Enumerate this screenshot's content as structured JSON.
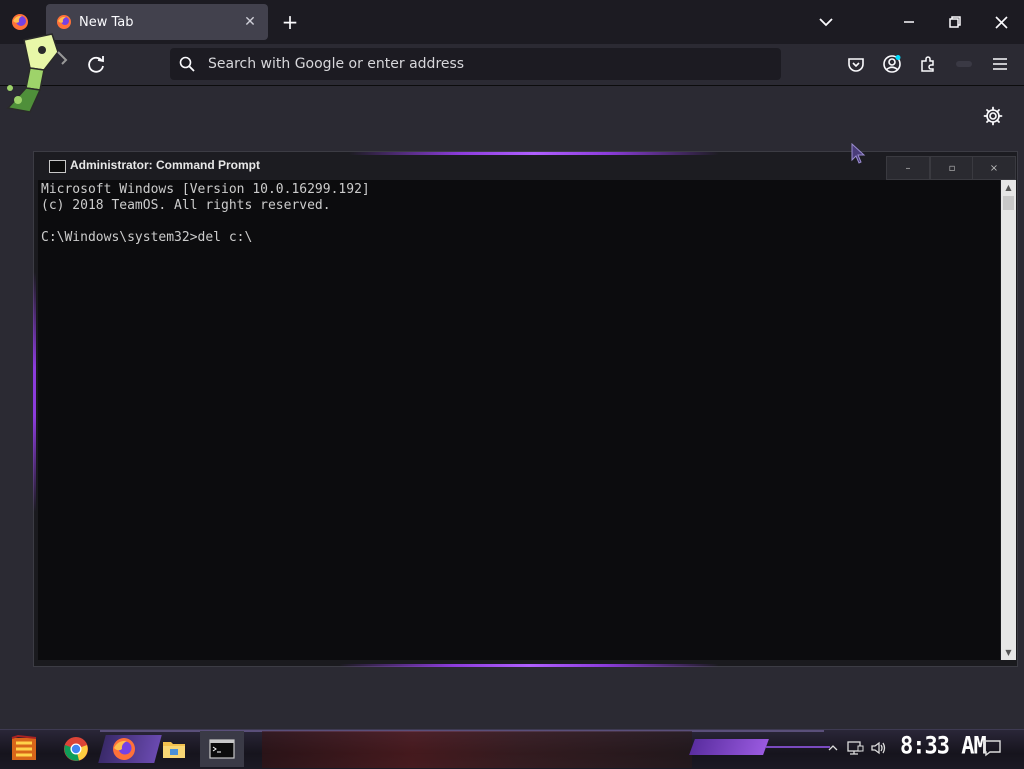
{
  "browser": {
    "tab": {
      "title": "New Tab",
      "close_glyph": "✕"
    },
    "newtab_glyph": "+",
    "urlbar": {
      "placeholder": "Search with Google or enter address",
      "value": ""
    },
    "toolbar_icons": [
      "pocket-icon",
      "account-icon",
      "extensions-icon",
      "menu-icon"
    ],
    "window_controls": {
      "minimize": "—",
      "restore": "❐",
      "close": "✕"
    }
  },
  "cmd": {
    "title": "Administrator: Command Prompt",
    "lines": "Microsoft Windows [Version 10.0.16299.192]\n(c) 2018 TeamOS. All rights reserved.\n\nC:\\Windows\\system32>del c:\\",
    "ctrl_minimize": "–",
    "ctrl_maximize": "▫",
    "ctrl_close": "×"
  },
  "taskbar": {
    "apps": [
      "chrome-icon",
      "firefox-icon",
      "file-explorer-icon",
      "command-prompt-icon"
    ],
    "clock": "8:33 AM"
  },
  "colors": {
    "accent_purple": "#8c3cdc",
    "chrome_bg": "#1c1b22",
    "toolbar_bg": "#2b2a33",
    "console_bg": "#0c0c0e"
  }
}
